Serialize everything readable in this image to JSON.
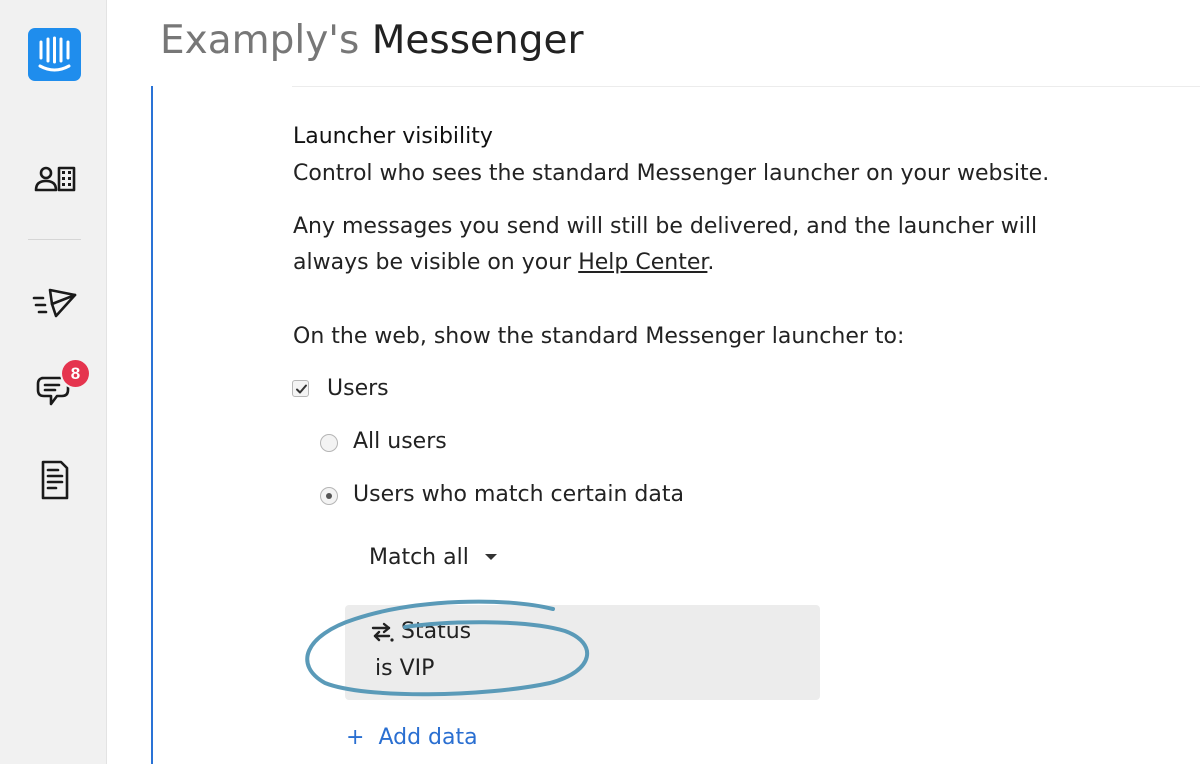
{
  "colors": {
    "accent": "#1f8ded",
    "link_blue": "#2a6fd1",
    "badge_red": "#e5344e",
    "annotation": "#5a9ab8"
  },
  "sidebar": {
    "logo_icon": "intercom-logo-icon",
    "items": [
      {
        "icon": "contacts-icon"
      },
      {
        "icon": "outbound-send-icon"
      },
      {
        "icon": "inbox-chat-icon",
        "badge": "8"
      },
      {
        "icon": "articles-icon"
      }
    ]
  },
  "header": {
    "title_prefix": "Examply's",
    "title_main": "Messenger"
  },
  "launcher": {
    "title": "Launcher visibility",
    "description": "Control who sees the standard Messenger launcher on your website.",
    "note_line1": "Any messages you send will still be delivered, and the launcher will",
    "note_line2_prefix": "always be visible on your ",
    "help_center_link": "Help Center",
    "note_line2_suffix": ".",
    "show_to_label": "On the web, show the standard Messenger launcher to:",
    "users_checkbox": {
      "label": "Users",
      "checked": true
    },
    "radio_all": {
      "label": "All users",
      "selected": false
    },
    "radio_match": {
      "label": "Users who match certain data",
      "selected": true
    },
    "match_dropdown": {
      "value": "Match all"
    },
    "filter": {
      "icon": "swap-arrows-icon",
      "attribute": "Status",
      "condition": "is VIP"
    },
    "add_data": {
      "plus": "+",
      "label": "Add data"
    }
  }
}
